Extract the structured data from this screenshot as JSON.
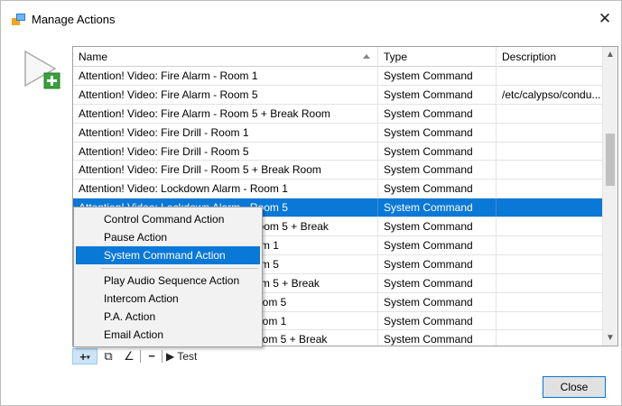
{
  "window": {
    "title": "Manage Actions",
    "close_glyph": "✕",
    "icon": "window-app-icon"
  },
  "add_action_icon": "play-add-icon",
  "grid": {
    "columns": [
      "Name",
      "Type",
      "Description"
    ],
    "sorted_column": "Name",
    "rows": [
      {
        "name": "Attention! Video: Fire Alarm - Room 1",
        "type": "System Command",
        "description": ""
      },
      {
        "name": "Attention! Video: Fire Alarm - Room 5",
        "type": "System Command",
        "description": "/etc/calypso/condu..."
      },
      {
        "name": "Attention! Video: Fire Alarm - Room 5 + Break Room",
        "type": "System Command",
        "description": ""
      },
      {
        "name": "Attention! Video: Fire Drill - Room 1",
        "type": "System Command",
        "description": ""
      },
      {
        "name": "Attention! Video: Fire Drill - Room 5",
        "type": "System Command",
        "description": ""
      },
      {
        "name": "Attention! Video: Fire Drill - Room 5 + Break Room",
        "type": "System Command",
        "description": ""
      },
      {
        "name": "Attention! Video: Lockdown Alarm - Room 1",
        "type": "System Command",
        "description": ""
      },
      {
        "name": "Attention! Video: Lockdown Alarm - Room 5",
        "type": "System Command",
        "description": "",
        "selected": true
      },
      {
        "name": "Attention! Video: Lockdown Alarm - Room 5 + Break",
        "type": "System Command",
        "description": ""
      },
      {
        "name": "Attention! Video: Lockdown Drill - Room 1",
        "type": "System Command",
        "description": ""
      },
      {
        "name": "Attention! Video: Lockdown Drill - Room 5",
        "type": "System Command",
        "description": ""
      },
      {
        "name": "Attention! Video: Lockdown Drill - Room 5 + Break",
        "type": "System Command",
        "description": ""
      },
      {
        "name": "Attention! Video: Severe Weather - Room 5",
        "type": "System Command",
        "description": ""
      },
      {
        "name": "Attention! Video: Severe Weather - Room 1",
        "type": "System Command",
        "description": ""
      },
      {
        "name": "Attention! Video: Severe Weather - Room 5 + Break",
        "type": "System Command",
        "description": ""
      }
    ]
  },
  "context_menu": {
    "group1": [
      "Control Command Action",
      "Pause Action",
      "System Command Action"
    ],
    "highlighted": "System Command Action",
    "group2": [
      "Play Audio Sequence Action",
      "Intercom Action",
      "P.A. Action",
      "Email Action"
    ]
  },
  "toolbar": {
    "add": "+",
    "add_caret": "▾",
    "copy_glyph": "⧉",
    "edit_glyph": "∠",
    "remove": "−",
    "test_label": "▶ Test"
  },
  "close_button": "Close",
  "colors": {
    "selection": "#0a78d7",
    "button_border": "#0078d7"
  }
}
